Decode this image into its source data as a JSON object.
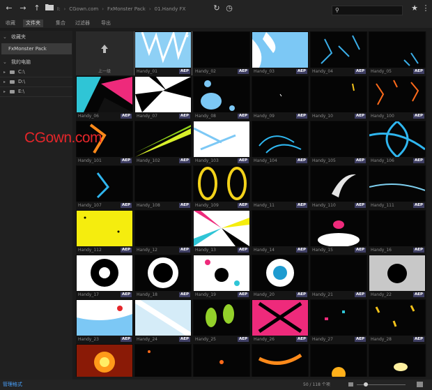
{
  "topbar": {
    "breadcrumbs": [
      "I:",
      "CGown.com",
      "FxMonster Pack",
      "01.Handy FX"
    ],
    "search": {
      "placeholder": "",
      "value": ""
    }
  },
  "tabs": [
    {
      "label": "收藏",
      "active": false
    },
    {
      "label": "文件夹",
      "active": true
    },
    {
      "label": "集合",
      "active": false
    },
    {
      "label": "过滤器",
      "active": false
    },
    {
      "label": "导出",
      "active": false
    }
  ],
  "sidebar": {
    "favorites_title": "收藏夹",
    "favorite_item": "FxMonster Pack",
    "computer_title": "我的电脑",
    "drives": [
      "C:\\",
      "D:\\",
      "E:\\"
    ]
  },
  "grid": {
    "up_label": "上一级",
    "items": [
      {
        "name": "Handy_01",
        "badge": "AEP"
      },
      {
        "name": "Handy_02",
        "badge": "AEP"
      },
      {
        "name": "Handy_03",
        "badge": "AEP"
      },
      {
        "name": "Handy_04",
        "badge": "AEP"
      },
      {
        "name": "Handy_05",
        "badge": "AEP"
      },
      {
        "name": "Handy_06",
        "badge": "AEP"
      },
      {
        "name": "Handy_07",
        "badge": "AEP"
      },
      {
        "name": "Handy_08",
        "badge": "AEP"
      },
      {
        "name": "Handy_09",
        "badge": "AEP"
      },
      {
        "name": "Handy_10",
        "badge": "AEP"
      },
      {
        "name": "Handy_100",
        "badge": "AEP"
      },
      {
        "name": "Handy_101",
        "badge": "AEP"
      },
      {
        "name": "Handy_102",
        "badge": "AEP"
      },
      {
        "name": "Handy_103",
        "badge": "AEP"
      },
      {
        "name": "Handy_104",
        "badge": "AEP"
      },
      {
        "name": "Handy_105",
        "badge": "AEP"
      },
      {
        "name": "Handy_106",
        "badge": "AEP"
      },
      {
        "name": "Handy_107",
        "badge": "AEP"
      },
      {
        "name": "Handy_108",
        "badge": "AEP"
      },
      {
        "name": "Handy_109",
        "badge": "AEP"
      },
      {
        "name": "Handy_11",
        "badge": "AEP"
      },
      {
        "name": "Handy_110",
        "badge": "AEP"
      },
      {
        "name": "Handy_111",
        "badge": "AEP"
      },
      {
        "name": "Handy_112",
        "badge": "AEP"
      },
      {
        "name": "Handy_12",
        "badge": "AEP"
      },
      {
        "name": "Handy_13",
        "badge": "AEP"
      },
      {
        "name": "Handy_14",
        "badge": "AEP"
      },
      {
        "name": "Handy_15",
        "badge": "AEP"
      },
      {
        "name": "Handy_16",
        "badge": "AEP"
      },
      {
        "name": "Handy_17",
        "badge": "AEP"
      },
      {
        "name": "Handy_18",
        "badge": "AEP"
      },
      {
        "name": "Handy_19",
        "badge": "AEP"
      },
      {
        "name": "Handy_20",
        "badge": "AEP"
      },
      {
        "name": "Handy_21",
        "badge": "AEP"
      },
      {
        "name": "Handy_22",
        "badge": "AEP"
      },
      {
        "name": "Handy_23",
        "badge": "AEP"
      },
      {
        "name": "Handy_24",
        "badge": "AEP"
      },
      {
        "name": "Handy_25",
        "badge": "AEP"
      },
      {
        "name": "Handy_26",
        "badge": "AEP"
      },
      {
        "name": "Handy_27",
        "badge": "AEP"
      },
      {
        "name": "Handy_28",
        "badge": "AEP"
      },
      {
        "name": "",
        "badge": ""
      },
      {
        "name": "",
        "badge": ""
      },
      {
        "name": "",
        "badge": ""
      },
      {
        "name": "",
        "badge": ""
      },
      {
        "name": "",
        "badge": ""
      },
      {
        "name": "",
        "badge": ""
      }
    ]
  },
  "watermark": "CGown.com",
  "status": {
    "left": "管理格式",
    "count": "50 / 118 个项"
  },
  "colors": {
    "accent": "#3f3f64",
    "link": "#4aa3ff",
    "watermark": "#e5262a"
  }
}
